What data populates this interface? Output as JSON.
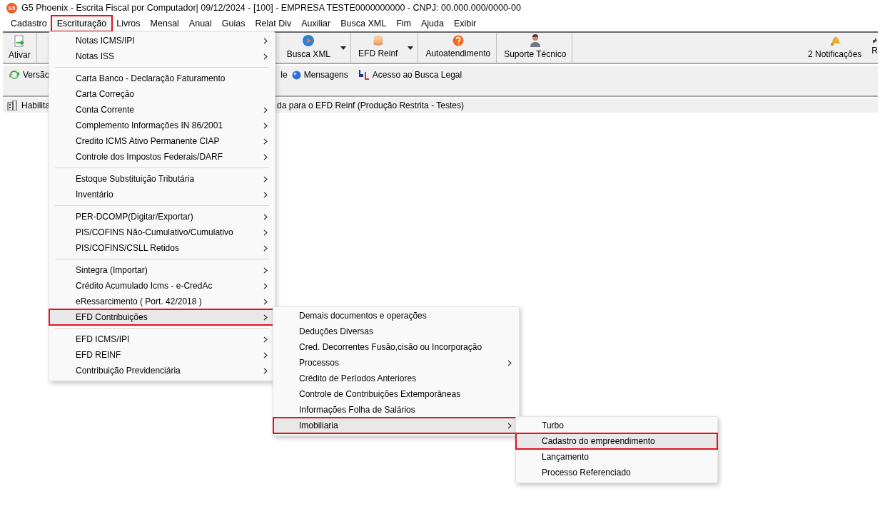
{
  "title_bar": {
    "logo_text": "G5",
    "title": "G5 Phoenix - Escrita Fiscal por Computador|  09/12/2024 - [100] - EMPRESA TESTE0000000000 - CNPJ: 00.000.000/0000-00"
  },
  "menu_bar": [
    {
      "label": "Cadastro",
      "selected": false
    },
    {
      "label": "Escrituração",
      "selected": true
    },
    {
      "label": "Livros",
      "selected": false
    },
    {
      "label": "Mensal",
      "selected": false
    },
    {
      "label": "Anual",
      "selected": false
    },
    {
      "label": "Guias",
      "selected": false
    },
    {
      "label": "Relat Div",
      "selected": false
    },
    {
      "label": "Auxiliar",
      "selected": false
    },
    {
      "label": "Busca XML",
      "selected": false
    },
    {
      "label": "Fim",
      "selected": false
    },
    {
      "label": "Ajuda",
      "selected": false
    },
    {
      "label": "Exibir",
      "selected": false
    }
  ],
  "toolbar": {
    "left": [
      {
        "label": "Ativar"
      }
    ],
    "middle": [
      {
        "label": "Busca XML",
        "dropdown": true
      },
      {
        "label": "EFD Reinf",
        "dropdown": true
      },
      {
        "label": "Autoatendimento",
        "dropdown": false
      },
      {
        "label": "Suporte Técnico",
        "dropdown": false
      }
    ],
    "right": [
      {
        "label": "2 Notificações"
      },
      {
        "label": "R"
      }
    ]
  },
  "quick_links": {
    "left": [
      "Versão"
    ],
    "right": [
      "le",
      "Mensagens",
      "Acesso ao Busca Legal"
    ]
  },
  "status_line": {
    "left": "Habilita",
    "right": "da para o EFD Reinf (Produção Restrita - Testes)"
  },
  "escrituracao_menu": {
    "groups": [
      [
        {
          "label": "Notas ICMS/IPI",
          "submenu": true,
          "selected": false
        },
        {
          "label": "Notas ISS",
          "submenu": true,
          "selected": false
        }
      ],
      [
        {
          "label": "Carta Banco - Declaração Faturamento",
          "submenu": false,
          "selected": false
        },
        {
          "label": "Carta Correção",
          "submenu": false,
          "selected": false
        },
        {
          "label": "Conta Corrente",
          "submenu": true,
          "selected": false
        },
        {
          "label": "Complemento Informações IN 86/2001",
          "submenu": true,
          "selected": false
        },
        {
          "label": "Credito ICMS Ativo Permanente CIAP",
          "submenu": true,
          "selected": false
        },
        {
          "label": "Controle dos Impostos Federais/DARF",
          "submenu": true,
          "selected": false
        }
      ],
      [
        {
          "label": "Estoque Substituição Tributária",
          "submenu": true,
          "selected": false
        },
        {
          "label": "Inventário",
          "submenu": true,
          "selected": false
        }
      ],
      [
        {
          "label": "PER-DCOMP(Digitar/Exportar)",
          "submenu": true,
          "selected": false
        },
        {
          "label": "PIS/COFINS Não-Cumulativo/Cumulativo",
          "submenu": true,
          "selected": false
        },
        {
          "label": "PIS/COFINS/CSLL Retidos",
          "submenu": true,
          "selected": false
        }
      ],
      [
        {
          "label": "Sintegra (Importar)",
          "submenu": true,
          "selected": false
        },
        {
          "label": "Crédito Acumulado Icms - e-CredAc",
          "submenu": true,
          "selected": false
        },
        {
          "label": "eRessarcimento ( Port. 42/2018 )",
          "submenu": true,
          "selected": false
        },
        {
          "label": "EFD Contribuições",
          "submenu": true,
          "selected": true
        }
      ],
      [
        {
          "label": "EFD ICMS/IPI",
          "submenu": true,
          "selected": false
        },
        {
          "label": "EFD REINF",
          "submenu": true,
          "selected": false
        },
        {
          "label": "Contribuição Previdenciária",
          "submenu": true,
          "selected": false
        }
      ]
    ]
  },
  "efd_contribuicoes_menu": {
    "items": [
      {
        "label": "Demais documentos e operações",
        "submenu": false,
        "selected": false
      },
      {
        "label": "Deduções Diversas",
        "submenu": false,
        "selected": false
      },
      {
        "label": "Cred. Decorrentes Fusão,cisão ou Incorporação",
        "submenu": false,
        "selected": false
      },
      {
        "label": "Processos",
        "submenu": true,
        "selected": false
      },
      {
        "label": "Crédito de Períodos Anteriores",
        "submenu": false,
        "selected": false
      },
      {
        "label": "Controle de Contribuições Extemporâneas",
        "submenu": false,
        "selected": false
      },
      {
        "label": "Informações Folha de Salários",
        "submenu": false,
        "selected": false
      },
      {
        "label": "Imobiliaria",
        "submenu": true,
        "selected": true
      }
    ]
  },
  "imobiliaria_menu": {
    "items": [
      {
        "label": "Turbo",
        "submenu": false,
        "selected": false
      },
      {
        "label": "Cadastro do empreendimento",
        "submenu": false,
        "selected": true
      },
      {
        "label": "Lançamento",
        "submenu": false,
        "selected": false
      },
      {
        "label": "Processo Referenciado",
        "submenu": false,
        "selected": false
      }
    ]
  }
}
